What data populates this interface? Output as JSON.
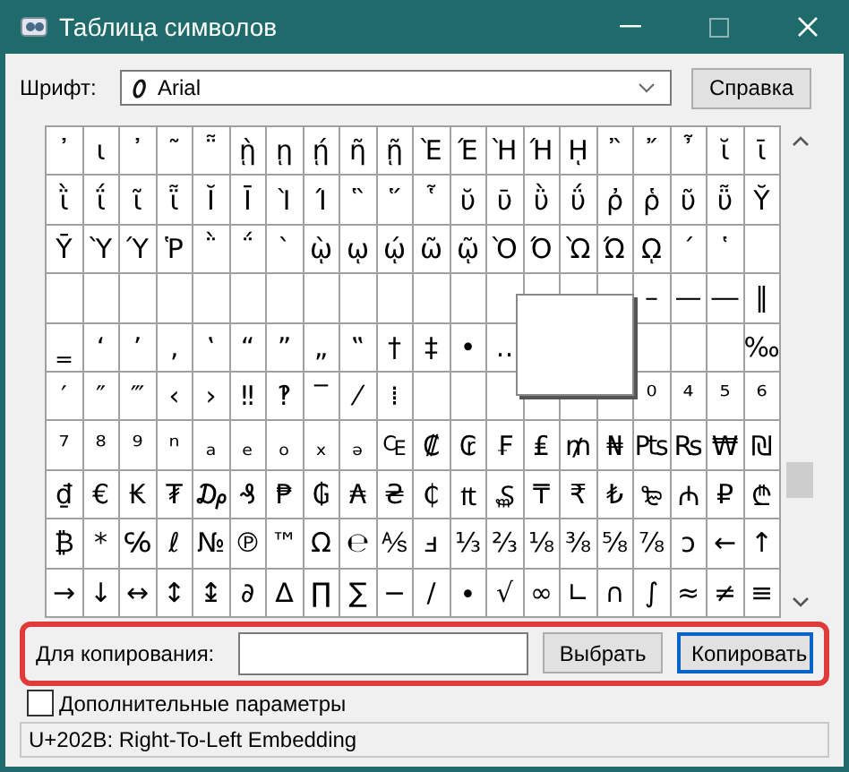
{
  "window": {
    "title": "Таблица символов"
  },
  "font": {
    "label": "Шрифт:",
    "value": "Arial",
    "help_button": "Справка"
  },
  "grid": {
    "rows": [
      [
        "᾽",
        "ι",
        "᾿",
        "῀",
        "῁",
        "ῂ",
        "ῃ",
        "ῄ",
        "ῆ",
        "ῇ",
        "Ὲ",
        "Έ",
        "Ὴ",
        "Ή",
        "ῌ",
        "῍",
        "῎",
        "῏",
        "ῐ",
        "ῑ"
      ],
      [
        "ῒ",
        "ΐ",
        "ῖ",
        "ῗ",
        "Ῐ",
        "Ῑ",
        "Ὶ",
        "Ί",
        "῝",
        "῞",
        "῟",
        "ῠ",
        "ῡ",
        "ῢ",
        "ΰ",
        "ῤ",
        "ῥ",
        "ῦ",
        "ῧ",
        "Ῠ"
      ],
      [
        "Ῡ",
        "Ὺ",
        "Ύ",
        "Ῥ",
        "῭",
        "΅",
        "`",
        "ῲ",
        "ῳ",
        "ῴ",
        "ῶ",
        "ῷ",
        "Ὸ",
        "Ό",
        "Ὼ",
        "Ώ",
        "ῼ",
        "´",
        "῾",
        null
      ],
      [
        null,
        null,
        null,
        null,
        null,
        null,
        null,
        null,
        null,
        null,
        null,
        null,
        null,
        null,
        null,
        null,
        "–",
        "—",
        "―",
        "‖"
      ],
      [
        "‗",
        "‘",
        "’",
        "‚",
        "‛",
        "“",
        "”",
        "„",
        "‟",
        "†",
        "‡",
        "•",
        "‥",
        null,
        null,
        null,
        null,
        null,
        null,
        "‰"
      ],
      [
        "′",
        "″",
        "‴",
        "‹",
        "›",
        "‼",
        "‽",
        "‾",
        "⁄",
        "⁞",
        null,
        null,
        null,
        null,
        null,
        null,
        "⁰",
        "⁴",
        "⁵",
        "⁶"
      ],
      [
        "⁷",
        "⁸",
        "⁹",
        "ⁿ",
        "ₐ",
        "ₑ",
        "ₒ",
        "ₓ",
        "ₔ",
        "₠",
        "₡",
        "₢",
        "₣",
        "₤",
        "₥",
        "₦",
        "₧",
        "₨",
        "₩",
        "₪"
      ],
      [
        "₫",
        "€",
        "₭",
        "₮",
        "₯",
        "₰",
        "₱",
        "₲",
        "₳",
        "₴",
        "₵",
        "₶",
        "₷",
        "₸",
        "₹",
        "₺",
        "₻",
        "₼",
        "₽",
        "₾"
      ],
      [
        "₿",
        "*",
        "℅",
        "ℓ",
        "№",
        "℗",
        "™",
        "Ω",
        "℮",
        "⅍",
        "ⅎ",
        "⅓",
        "⅔",
        "⅛",
        "⅜",
        "⅝",
        "⅞",
        "ↄ",
        "←",
        "↑"
      ],
      [
        "→",
        "↓",
        "↔",
        "↕",
        "↨",
        "∂",
        "∆",
        "∏",
        "∑",
        "−",
        "∕",
        "∙",
        "√",
        "∞",
        "∟",
        "∩",
        "∫",
        "≈",
        "≠",
        "≡"
      ]
    ]
  },
  "copy": {
    "label": "Для копирования:",
    "highlighted": true,
    "select_button": "Выбрать",
    "copy_button": "Копировать"
  },
  "advanced": {
    "label": "Дополнительные параметры",
    "checked": false
  },
  "status_bar": "U+202B: Right-To-Left Embedding"
}
